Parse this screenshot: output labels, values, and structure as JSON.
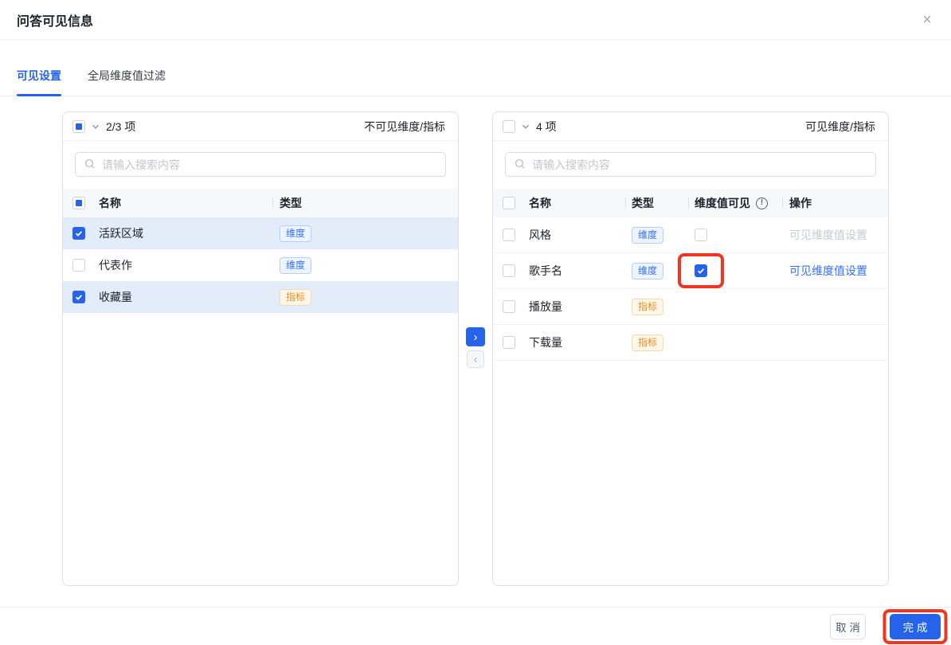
{
  "dialog": {
    "title": "问答可见信息",
    "close_glyph": "×"
  },
  "tabs": [
    {
      "label": "可见设置",
      "active": true
    },
    {
      "label": "全局维度值过滤",
      "active": false
    }
  ],
  "left_panel": {
    "select_all_state": "indeterminate",
    "count_label": "2/3 项",
    "panel_label": "不可见维度/指标",
    "search_placeholder": "请输入搜索内容",
    "search_value": "",
    "columns": [
      "名称",
      "类型"
    ],
    "rows": [
      {
        "name": "活跃区域",
        "type": "维度",
        "checked": true
      },
      {
        "name": "代表作",
        "type": "维度",
        "checked": false
      },
      {
        "name": "收藏量",
        "type": "指标",
        "checked": true
      }
    ]
  },
  "transfer": {
    "move_right_glyph": "›",
    "move_left_glyph": "‹"
  },
  "right_panel": {
    "select_all_state": "unchecked",
    "count_label": "4 项",
    "panel_label": "可见维度/指标",
    "search_placeholder": "请输入搜索内容",
    "search_value": "",
    "columns": [
      "名称",
      "类型",
      "维度值可见",
      "操作"
    ],
    "info_glyph": "!",
    "rows": [
      {
        "name": "风格",
        "type": "维度",
        "checked": false,
        "dim_value_visible": false,
        "action": "可见维度值设置",
        "action_enabled": false
      },
      {
        "name": "歌手名",
        "type": "维度",
        "checked": false,
        "dim_value_visible": true,
        "action": "可见维度值设置",
        "action_enabled": true,
        "annotated": true
      },
      {
        "name": "播放量",
        "type": "指标",
        "checked": false
      },
      {
        "name": "下载量",
        "type": "指标",
        "checked": false
      }
    ]
  },
  "footer": {
    "cancel_label": "取 消",
    "done_label": "完 成",
    "done_annotated": true
  },
  "colors": {
    "primary_blue": "#2563eb",
    "link_blue": "#3370ff",
    "dimension_tag_text": "#3370ff",
    "metric_tag_text": "#ef8d1f",
    "row_highlight": "#e3ecf9",
    "annotation_red": "#f03622"
  },
  "icons": {
    "close": "x-mark",
    "search": "magnifier",
    "select_expander": "chevron-down",
    "dim_visible_help": "exclamation-circle",
    "checked_box": "check-mark",
    "move_right": "chevron-right",
    "move_left": "chevron-left"
  }
}
